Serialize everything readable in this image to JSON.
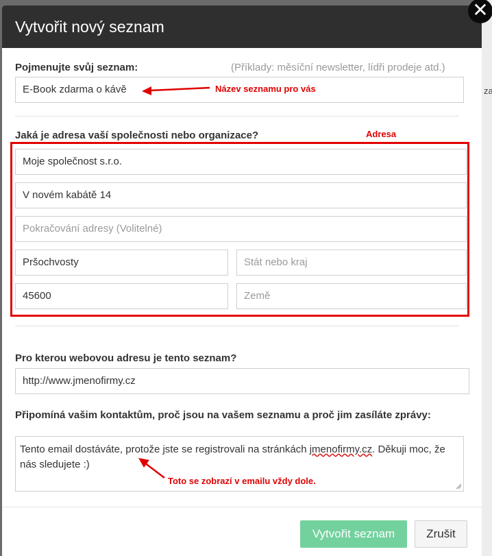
{
  "background": {
    "partial_text": "za"
  },
  "dialog": {
    "title": "Vytvořit nový seznam",
    "close_symbol": "✕"
  },
  "list_name": {
    "label": "Pojmenujte svůj seznam:",
    "hint": "(Příklady: měsíční newsletter, lídři prodeje atd.)",
    "value": "E-Book zdarma o kávě",
    "annotation": "Název seznamu pro vás"
  },
  "address": {
    "label": "Jaká je adresa vaší společnosti nebo organizace?",
    "annotation": "Adresa",
    "company": "Moje společnost s.r.o.",
    "street": "V novém kabátě 14",
    "street2_placeholder": "Pokračování adresy (Volitelné)",
    "city": "Pršochvosty",
    "state_placeholder": "Stát nebo kraj",
    "zip": "45600",
    "country_placeholder": "Země"
  },
  "website": {
    "label": "Pro kterou webovou adresu je tento seznam?",
    "value": "http://www.jmenofirmy.cz"
  },
  "reminder": {
    "label": "Připomíná vašim kontaktům, proč jsou na vašem seznamu a proč jim zasíláte zprávy:",
    "text_before": "Tento email dostáváte, protože jste se registrovali na stránkách ",
    "text_link": "jmenofirmy.cz",
    "text_after": ". Děkuji moc, že nás sledujete :)",
    "annotation": "Toto se zobrazí v emailu vždy dole."
  },
  "footer": {
    "create_label": "Vytvořit seznam",
    "cancel_label": "Zrušit"
  },
  "colors": {
    "header_bg": "#2f2f2f",
    "primary_button": "#72d19d",
    "annotation_red": "#e00000"
  }
}
